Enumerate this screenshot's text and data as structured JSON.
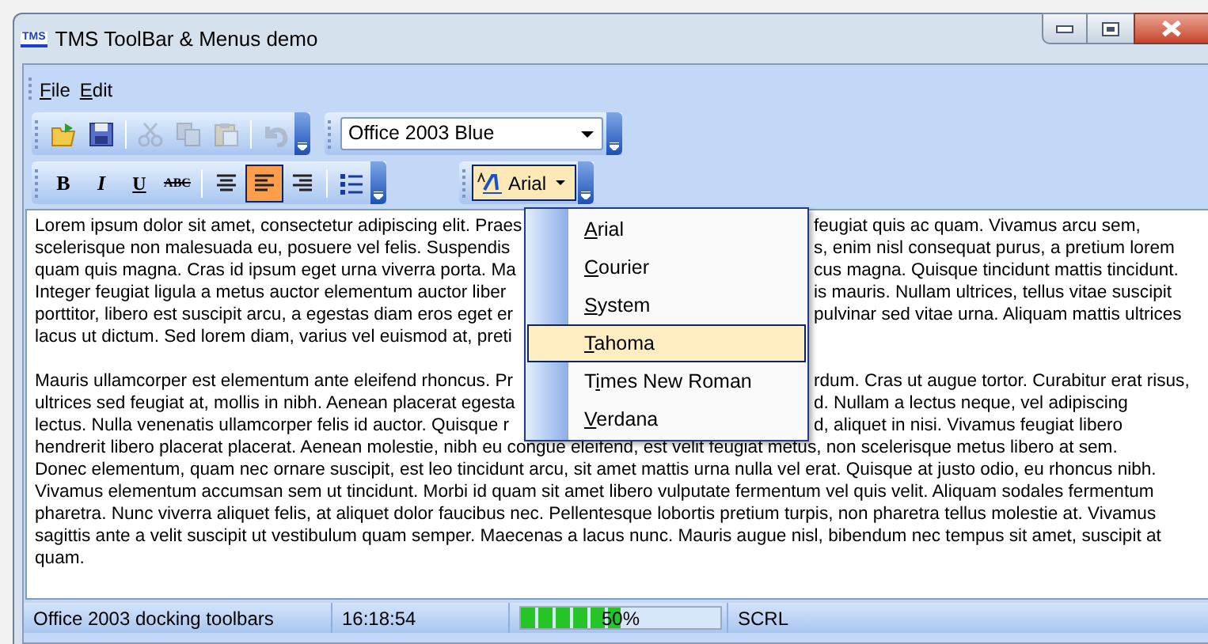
{
  "window": {
    "title": "TMS ToolBar & Menus demo",
    "app_icon_text": "TMS"
  },
  "menu_bar": [
    {
      "label": "File"
    },
    {
      "label": "Edit"
    }
  ],
  "toolbar_rows": [
    {
      "toolbars": [
        {
          "items": [
            {
              "kind": "icon",
              "disabled": false
            },
            {
              "kind": "icon",
              "disabled": false
            },
            {
              "kind": "separator"
            },
            {
              "kind": "icon",
              "disabled": true
            },
            {
              "kind": "icon",
              "disabled": true
            },
            {
              "kind": "icon",
              "disabled": true
            },
            {
              "kind": "separator"
            },
            {
              "kind": "icon",
              "disabled": true
            }
          ]
        },
        {
          "items": [
            {
              "kind": "combo",
              "value": "Office 2003 Blue"
            }
          ]
        }
      ]
    },
    {
      "toolbars": [
        {
          "items": [
            {
              "kind": "letter",
              "label": "B",
              "selected": false
            },
            {
              "kind": "letter",
              "label": "I",
              "selected": false
            },
            {
              "kind": "letter",
              "label": "U",
              "selected": false
            },
            {
              "kind": "letter",
              "label": "ABC",
              "selected": false
            },
            {
              "kind": "separator"
            },
            {
              "kind": "icon",
              "selected": false
            },
            {
              "kind": "icon",
              "selected": true
            },
            {
              "kind": "icon",
              "selected": false
            },
            {
              "kind": "separator"
            },
            {
              "kind": "icon",
              "selected": false
            }
          ]
        },
        {
          "items": [
            {
              "kind": "font-combo",
              "value": "Arial"
            }
          ]
        }
      ]
    }
  ],
  "editor": {
    "lines": [
      {
        "kind": "split",
        "left": "Lorem ipsum dolor sit amet, consectetur adipiscing elit. Praes",
        "right": "feugiat quis ac quam. Vivamus arcu sem,"
      },
      {
        "kind": "split",
        "left": "scelerisque non malesuada eu, posuere vel felis. Suspendis",
        "right": "s, enim nisl consequat purus, a pretium lorem"
      },
      {
        "kind": "split",
        "left": "quam quis magna. Cras id ipsum eget urna viverra porta. Ma",
        "right": "cus magna. Quisque tincidunt mattis tincidunt."
      },
      {
        "kind": "split",
        "left": "Integer feugiat ligula a metus auctor elementum auctor liber",
        "right": "is mauris. Nullam ultrices, tellus vitae suscipit"
      },
      {
        "kind": "split",
        "left": "porttitor, libero est suscipit arcu, a egestas diam eros eget er",
        "right": "pulvinar sed vitae urna. Aliquam mattis ultrices"
      },
      {
        "kind": "split",
        "left": "lacus ut dictum. Sed lorem diam, varius vel euismod at, preti"
      },
      {
        "kind": "blank"
      },
      {
        "kind": "split",
        "left": "Mauris ullamcorper est elementum ante eleifend rhoncus. Pr",
        "right": "rdum. Cras ut augue tortor. Curabitur erat risus,"
      },
      {
        "kind": "split",
        "left": "ultrices sed feugiat at, mollis in nibh. Aenean placerat egesta",
        "right": "d. Nullam a lectus neque, vel adipiscing"
      },
      {
        "kind": "split",
        "left": "lectus. Nulla venenatis ullamcorper felis id auctor. Quisque r",
        "right": "d, aliquet in nisi. Vivamus feugiat libero"
      },
      {
        "kind": "full",
        "text": "hendrerit libero placerat placerat. Aenean molestie, nibh eu congue eleifend, est velit feugiat metus, non scelerisque metus libero at sem."
      },
      {
        "kind": "full",
        "text": "Donec elementum, quam nec ornare suscipit, est leo tincidunt arcu, sit amet mattis urna nulla vel erat. Quisque at justo odio, eu rhoncus nibh."
      },
      {
        "kind": "full",
        "text": "Vivamus elementum accumsan sem ut tincidunt. Morbi id quam sit amet libero vulputate fermentum vel quis velit. Aliquam sodales fermentum"
      },
      {
        "kind": "full",
        "text": "pharetra. Nunc viverra aliquet felis, at aliquet dolor faucibus nec. Pellentesque lobortis pretium turpis, non pharetra tellus molestie at. Vivamus"
      },
      {
        "kind": "full",
        "text": "sagittis ante a velit suscipit ut vestibulum quam semper. Maecenas a lacus nunc. Mauris augue nisl, bibendum nec tempus sit amet, suscipit at"
      },
      {
        "kind": "full",
        "text": "quam."
      }
    ]
  },
  "font_menu": [
    {
      "label": "Arial",
      "selected": false
    },
    {
      "label": "Courier",
      "selected": false
    },
    {
      "label": "System",
      "selected": false
    },
    {
      "label": "Tahoma",
      "selected": true
    },
    {
      "label": "Times New Roman",
      "selected": false
    },
    {
      "label": "Verdana",
      "selected": false
    }
  ],
  "status_bar": [
    {
      "kind": "text",
      "text": "Office 2003 docking toolbars"
    },
    {
      "kind": "text",
      "text": "16:18:54"
    },
    {
      "kind": "progress",
      "level": 0.5,
      "text": "50%"
    },
    {
      "kind": "text",
      "text": "SCRL"
    }
  ]
}
